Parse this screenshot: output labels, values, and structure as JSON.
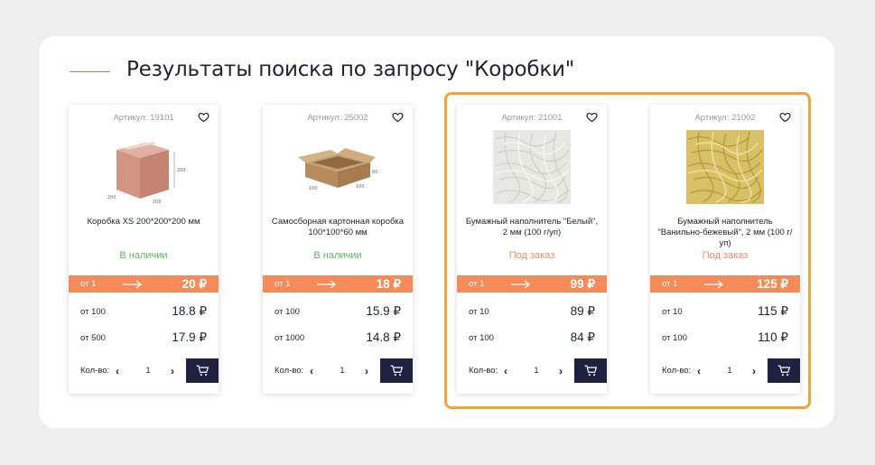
{
  "header": {
    "title": "Результаты поиска по запросу \"Коробки\""
  },
  "colors": {
    "accent": "#f58b5a",
    "highlight": "#f3a434",
    "dark": "#1e2240",
    "in_stock": "#5fb55f",
    "on_order": "#f08c64"
  },
  "products": [
    {
      "sku": "Артикул: 19101",
      "image": "box-cube-image",
      "name": "Коробка XS 200*200*200 мм",
      "availability": "В наличии",
      "main_qty": "от 1",
      "main_price": "20 ₽",
      "tiers": [
        {
          "qty": "от 100",
          "price": "18.8 ₽"
        },
        {
          "qty": "от 500",
          "price": "17.9 ₽"
        }
      ],
      "qty_label": "Кол-во:",
      "qty": "1"
    },
    {
      "sku": "Артикул: 25002",
      "image": "flat-box-image",
      "name": "Самосборная картонная коробка 100*100*60 мм",
      "availability": "В наличии",
      "main_qty": "от 1",
      "main_price": "18 ₽",
      "tiers": [
        {
          "qty": "от 100",
          "price": "15.9 ₽"
        },
        {
          "qty": "от 1000",
          "price": "14.8 ₽"
        }
      ],
      "qty_label": "Кол-во:",
      "qty": "1"
    },
    {
      "sku": "Артикул: 21001",
      "image": "white-filler-image",
      "name": "Бумажный наполнитель \"Белый\", 2 мм (100 г/уп)",
      "availability": "Под заказ",
      "main_qty": "от 1",
      "main_price": "99 ₽",
      "tiers": [
        {
          "qty": "от 10",
          "price": "89 ₽"
        },
        {
          "qty": "от 100",
          "price": "84 ₽"
        }
      ],
      "qty_label": "Кол-во:",
      "qty": "1"
    },
    {
      "sku": "Артикул: 21002",
      "image": "beige-filler-image",
      "name": "Бумажный наполнитель \"Ванильно-бежевый\", 2 мм (100 г/уп)",
      "availability": "Под заказ",
      "main_qty": "от 1",
      "main_price": "125 ₽",
      "tiers": [
        {
          "qty": "от 10",
          "price": "115 ₽"
        },
        {
          "qty": "от 100",
          "price": "110 ₽"
        }
      ],
      "qty_label": "Кол-во:",
      "qty": "1"
    }
  ]
}
